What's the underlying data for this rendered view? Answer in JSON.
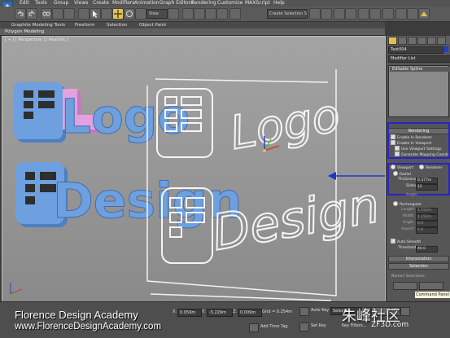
{
  "menubar": {
    "items": [
      "Edit",
      "Tools",
      "Group",
      "Views",
      "Create",
      "Modifiers",
      "Animation",
      "Graph Editors",
      "Rendering",
      "Customize",
      "MAXScript",
      "Help"
    ]
  },
  "toolbar": {
    "view_select": "View",
    "selection_set": "Create Selection Se"
  },
  "ribbon": {
    "tabs": [
      "Graphite Modeling Tools",
      "Freeform",
      "Selection",
      "Object Paint"
    ],
    "active_panel": "Polygon Modeling"
  },
  "viewport": {
    "label": "[ + ] [ Perspective ] [ Realistic ]",
    "scene_text_solid_top": "Logo",
    "scene_text_solid_bottom": "Design",
    "scene_text_wire_top": "Logo",
    "scene_text_wire_bottom": "Design"
  },
  "command_panel": {
    "object_name": "Text004",
    "object_color": "#1f3fc8",
    "modifier_list": "Modifier List",
    "stack_item": "Editable Spline",
    "rendering_rollout": "Rendering",
    "enable_in_renderer": "Enable In Renderer",
    "enable_in_viewport": "Enable In Viewport",
    "use_viewport_settings": "Use Viewport Settings",
    "generate_mapping": "Generate Mapping Coords",
    "viewport_option": "Viewport",
    "renderer_option": "Renderer",
    "radial_label": "Radial",
    "thickness_label": "Thickness:",
    "thickness_value": "0.377m",
    "sides_label": "Sides:",
    "sides_value": "12",
    "angle_label": "Angle:",
    "rectangular_label": "Rectangular",
    "length_label": "Length:",
    "length_value": "1.152m",
    "width_label": "Width:",
    "width_value": "1.152m",
    "angle2_label": "Angle:",
    "angle2_value": "0.0",
    "aspect_label": "Aspect:",
    "aspect_value": "1.0",
    "auto_smooth_label": "Auto Smooth",
    "threshold_label": "Threshold:",
    "threshold_value": "40.0",
    "interpolation_rollout": "Interpolation",
    "selection_rollout": "Selection",
    "named_sel_label": "Named Selections:",
    "tooltip": "Command Panel"
  },
  "status": {
    "x_value": "0.059m",
    "y_value": "-5.229m",
    "z_value": "0.009m",
    "grid_value": "Grid = 0.254m",
    "auto_key": "Auto Key",
    "set_key": "Set Key",
    "selected_value": "Selected",
    "key_filters": "Key Filters...",
    "add_time_tag": "Add Time Tag"
  },
  "watermark": {
    "academy": "Florence Design Academy",
    "url": "www.FlorenceDesignAcademy.com",
    "site_cn": "朱峰社区",
    "site_en": "ZF3D.com"
  },
  "colors": {
    "accent_box": "#2a22c8",
    "logo_blue": "#5b8fd3",
    "logo_pink": "#d58ad0",
    "arrow": "#2233cc"
  }
}
